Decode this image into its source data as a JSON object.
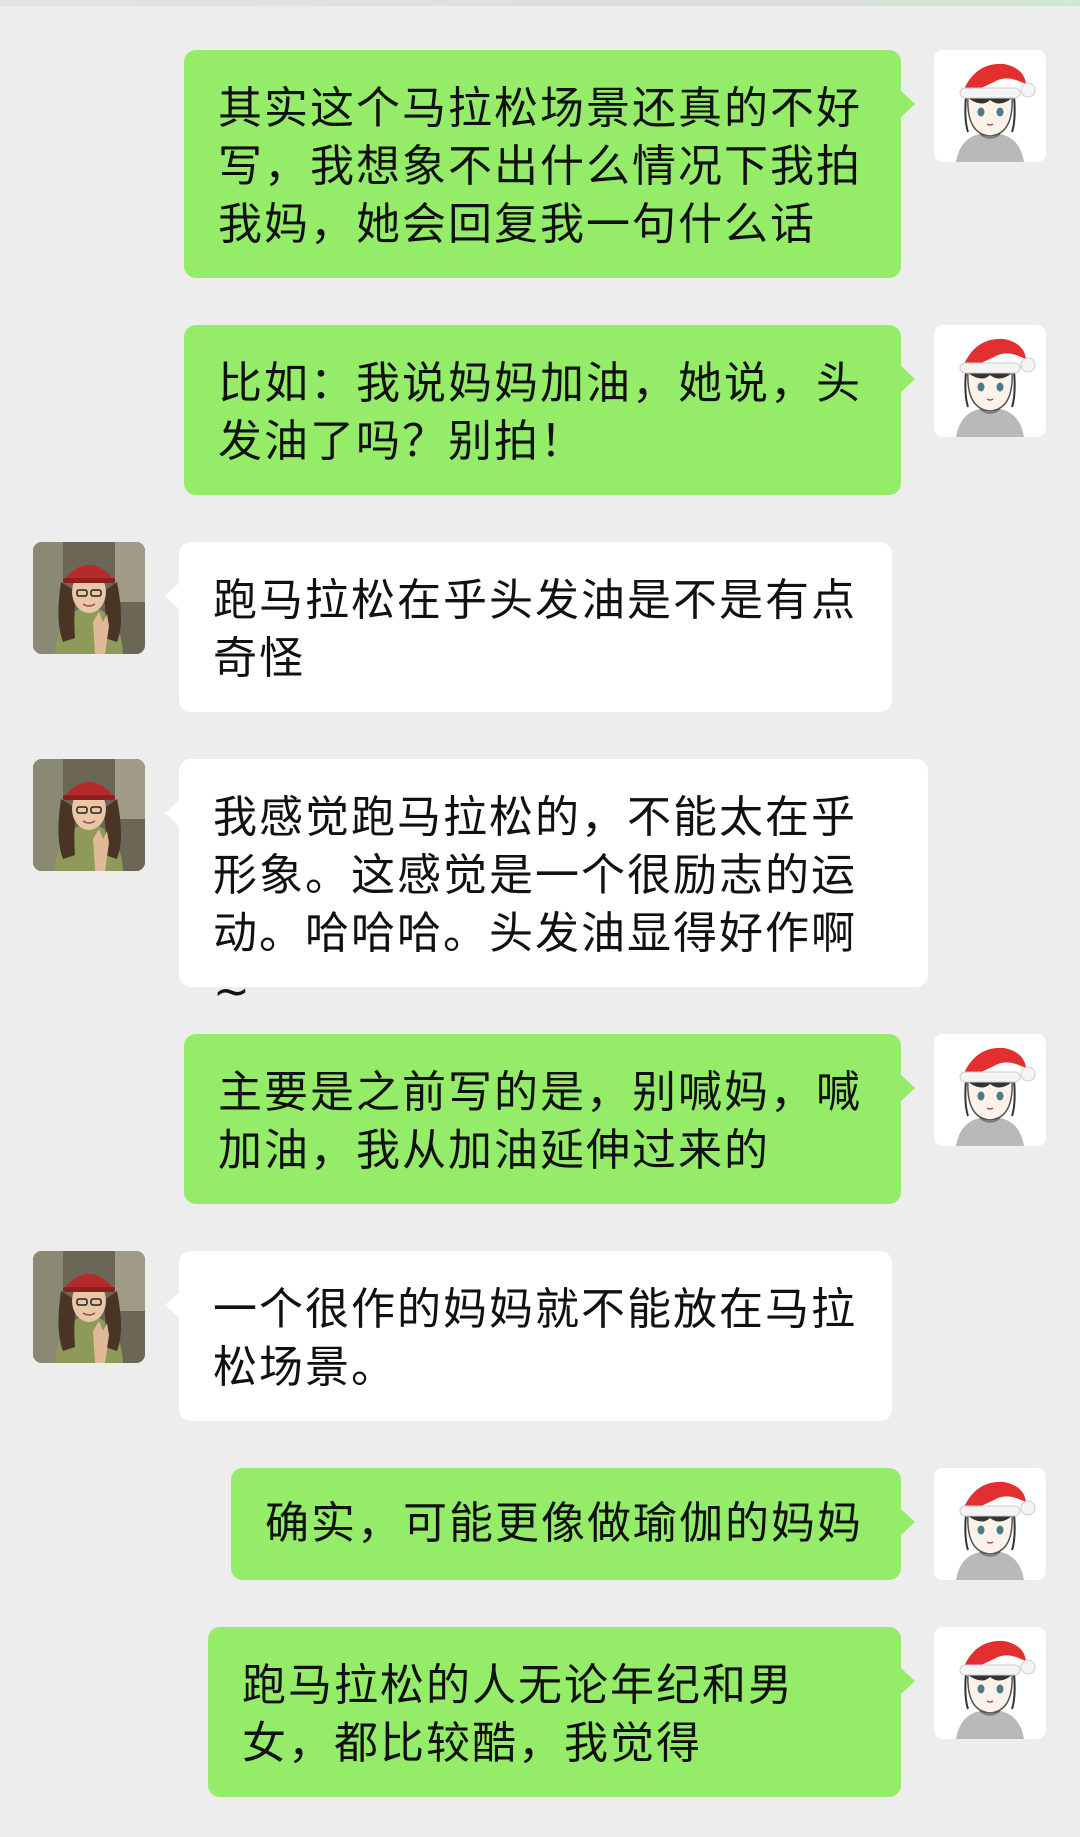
{
  "messages": [
    {
      "side": "me",
      "text": "其实这个马拉松场景还真的不好写，我想象不出什么情况下我拍我妈，她会回复我一句什么话"
    },
    {
      "side": "me",
      "text": "比如：我说妈妈加油，她说，头发油了吗？别拍！"
    },
    {
      "side": "friend",
      "text": "跑马拉松在乎头发油是不是有点奇怪"
    },
    {
      "side": "friend",
      "text": "我感觉跑马拉松的，不能太在乎形象。这感觉是一个很励志的运动。哈哈哈。头发油显得好作啊~"
    },
    {
      "side": "me",
      "text": "主要是之前写的是，别喊妈，喊加油，我从加油延伸过来的"
    },
    {
      "side": "friend",
      "text": "一个很作的妈妈就不能放在马拉松场景。"
    },
    {
      "side": "me",
      "text": "确实，可能更像做瑜伽的妈妈"
    },
    {
      "side": "me",
      "text": "跑马拉松的人无论年纪和男女，都比较酷，我觉得"
    }
  ],
  "icons": {
    "me_avatar": "avatar-santa-hat-cartoon-girl",
    "friend_avatar": "avatar-photo-girl-red-cap"
  },
  "colors": {
    "background": "#ededed",
    "my_bubble": "#95ec69",
    "friend_bubble": "#ffffff"
  }
}
